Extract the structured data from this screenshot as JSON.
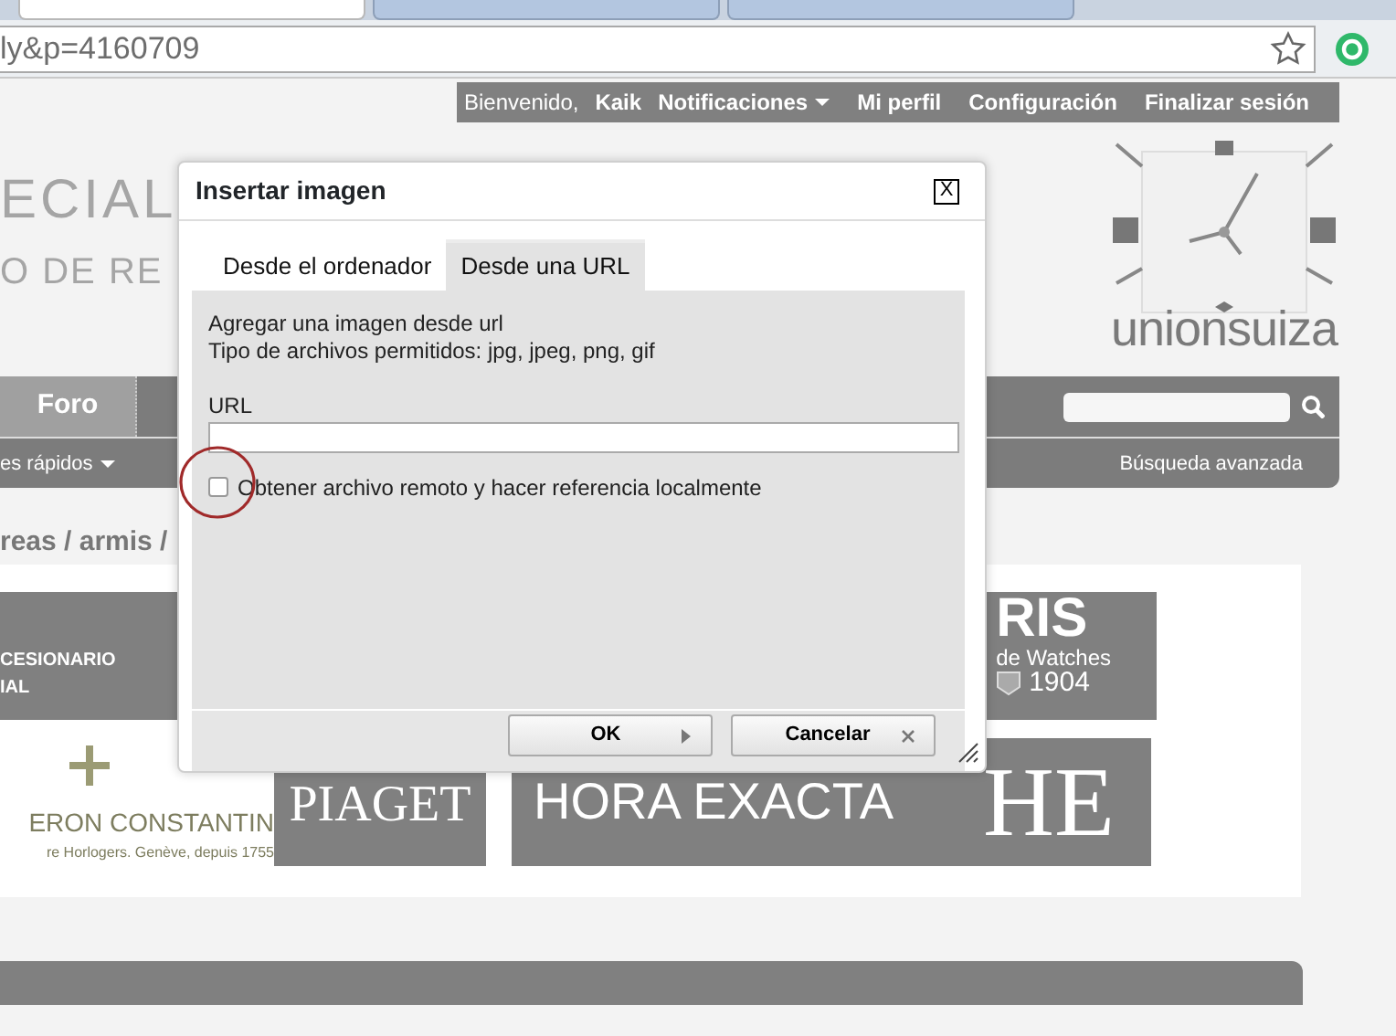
{
  "browser": {
    "tabs": [
      {
        "selected": true
      },
      {
        "selected": false
      },
      {
        "selected": false
      }
    ],
    "address": "ly&p=4160709"
  },
  "user_bar": {
    "items": [
      {
        "kind": "text",
        "label": "Bienvenido,"
      },
      {
        "kind": "user",
        "label": "Kaik"
      },
      {
        "kind": "menu",
        "label": "Notificaciones"
      },
      {
        "kind": "link",
        "label": "Mi perfil"
      },
      {
        "kind": "link",
        "label": "Configuración"
      },
      {
        "kind": "link",
        "label": "Finalizar sesión"
      }
    ]
  },
  "site_logo": {
    "line_1": "ECIAL",
    "line_2": "O DE RE"
  },
  "sponsor_logo": {
    "name": "unionsuiza"
  },
  "nav": {
    "tabs": [
      {
        "label": "Foro",
        "selected": true
      }
    ],
    "quick_links": "es rápidos",
    "advanced_search": "Búsqueda avanzada"
  },
  "breadcrumb": "reas / armis /",
  "banners": {
    "row_1": [
      {
        "kind": "dealer",
        "lines": [
          "CESIONARIO",
          "IAL"
        ]
      },
      {
        "kind": "oris",
        "title": "RIS",
        "lines": [
          "de Watches",
          "1904"
        ]
      }
    ],
    "row_2": [
      {
        "kind": "vacheron",
        "title": "ERON CONSTANTIN",
        "subtitle": "re Horlogers. Genève, depuis 1755"
      },
      {
        "kind": "piaget",
        "title": "PIAGET"
      },
      {
        "kind": "hora",
        "title": "HORA EXACTA",
        "mark": "HE"
      }
    ]
  },
  "dialog": {
    "title": "Insertar imagen",
    "close": "X",
    "tabs": [
      {
        "label": "Desde el ordenador",
        "selected": false
      },
      {
        "label": "Desde una URL",
        "selected": true
      }
    ],
    "intro": [
      "Agregar una imagen desde url",
      "Tipo de archivos permitidos: jpg, jpeg, png, gif"
    ],
    "url_label": "URL",
    "checkbox": {
      "label": "Obtener archivo remoto y hacer referencia localmente",
      "checked": false
    },
    "buttons": [
      {
        "kind": "ok",
        "label": "OK"
      },
      {
        "kind": "cancel",
        "label": "Cancelar"
      }
    ]
  }
}
